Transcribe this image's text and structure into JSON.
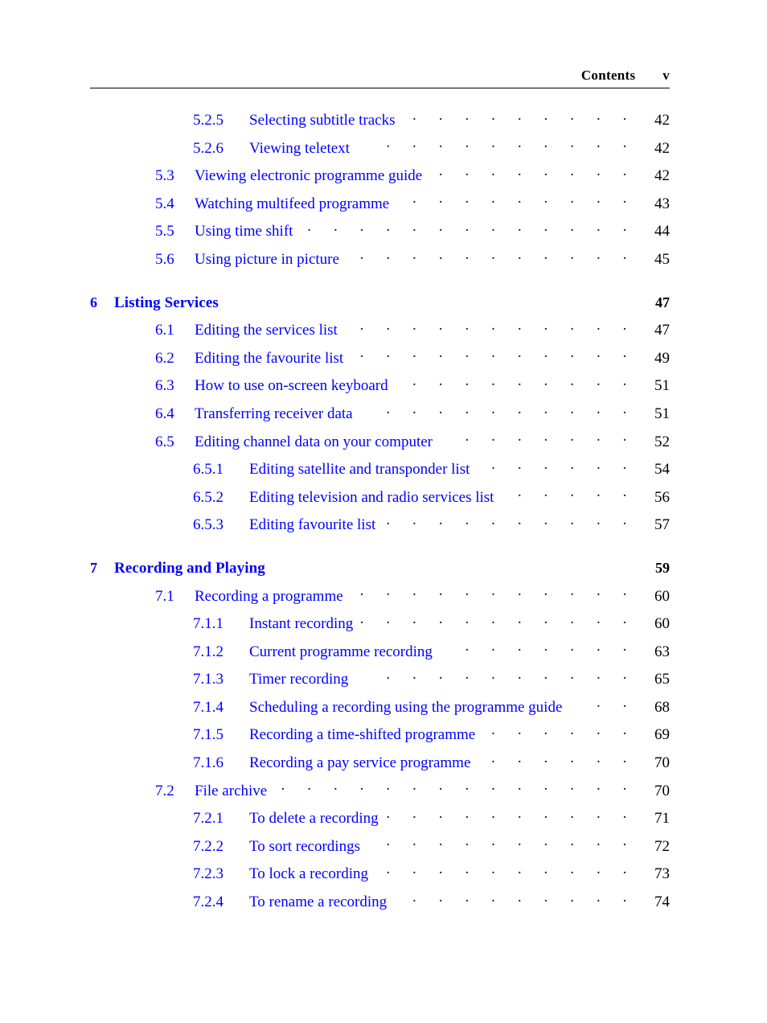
{
  "header": {
    "title": "Contents",
    "folio": "v"
  },
  "colors": {
    "link_blue": "#0000FF",
    "text_black": "#000000",
    "leader_dot": "#151515"
  },
  "toc": {
    "entries": [
      {
        "level": 3,
        "number": "5.2.5",
        "title": "Selecting subtitle tracks",
        "page": "42",
        "gap": "wide"
      },
      {
        "level": 3,
        "number": "5.2.6",
        "title": "Viewing teletext",
        "page": "42",
        "gap": "wide"
      },
      {
        "level": 2,
        "number": "5.3",
        "title": "Viewing electronic programme guide",
        "page": "42",
        "gap": "wide"
      },
      {
        "level": 2,
        "number": "5.4",
        "title": "Watching multifeed programme",
        "page": "43",
        "gap": "wide"
      },
      {
        "level": 2,
        "number": "5.5",
        "title": "Using time shift",
        "page": "44",
        "gap": "none"
      },
      {
        "level": 2,
        "number": "5.6",
        "title": "Using picture in picture",
        "page": "45",
        "gap": "wide"
      },
      {
        "level": 1,
        "number": "6",
        "title": "Listing Services",
        "page": "47",
        "gap": "none"
      },
      {
        "level": 2,
        "number": "6.1",
        "title": "Editing the services list",
        "page": "47",
        "gap": "none"
      },
      {
        "level": 2,
        "number": "6.2",
        "title": "Editing the favourite list",
        "page": "49",
        "gap": "none"
      },
      {
        "level": 2,
        "number": "6.3",
        "title": "How to use on-screen keyboard",
        "page": "51",
        "gap": "none"
      },
      {
        "level": 2,
        "number": "6.4",
        "title": "Transferring receiver data",
        "page": "51",
        "gap": "wide"
      },
      {
        "level": 2,
        "number": "6.5",
        "title": "Editing channel data on your computer",
        "page": "52",
        "gap": "wide"
      },
      {
        "level": 3,
        "number": "6.5.1",
        "title": "Editing satellite and transponder list",
        "page": "54",
        "gap": "wide"
      },
      {
        "level": 3,
        "number": "6.5.2",
        "title": "Editing television and radio services list",
        "page": "56",
        "gap": "wide"
      },
      {
        "level": 3,
        "number": "6.5.3",
        "title": "Editing favourite list",
        "page": "57",
        "gap": "none"
      },
      {
        "level": 1,
        "number": "7",
        "title": "Recording and Playing",
        "page": "59",
        "gap": "none"
      },
      {
        "level": 2,
        "number": "7.1",
        "title": "Recording a programme",
        "page": "60",
        "gap": "none"
      },
      {
        "level": 3,
        "number": "7.1.1",
        "title": "Instant recording",
        "page": "60",
        "gap": "none"
      },
      {
        "level": 3,
        "number": "7.1.2",
        "title": "Current programme recording",
        "page": "63",
        "gap": "wide"
      },
      {
        "level": 3,
        "number": "7.1.3",
        "title": "Timer recording",
        "page": "65",
        "gap": "wide"
      },
      {
        "level": 3,
        "number": "7.1.4",
        "title": "Scheduling a recording using the programme guide",
        "page": "68",
        "gap": "wide"
      },
      {
        "level": 3,
        "number": "7.1.5",
        "title": "Recording a time-shifted programme",
        "page": "69",
        "gap": "wide"
      },
      {
        "level": 3,
        "number": "7.1.6",
        "title": "Recording a pay service programme",
        "page": "70",
        "gap": "none"
      },
      {
        "level": 2,
        "number": "7.2",
        "title": "File archive",
        "page": "70",
        "gap": "wide"
      },
      {
        "level": 3,
        "number": "7.2.1",
        "title": "To delete a recording",
        "page": "71",
        "gap": "none"
      },
      {
        "level": 3,
        "number": "7.2.2",
        "title": "To sort recordings",
        "page": "72",
        "gap": "wide"
      },
      {
        "level": 3,
        "number": "7.2.3",
        "title": "To lock a recording",
        "page": "73",
        "gap": "none"
      },
      {
        "level": 3,
        "number": "7.2.4",
        "title": "To rename a recording",
        "page": "74",
        "gap": "none"
      }
    ]
  }
}
